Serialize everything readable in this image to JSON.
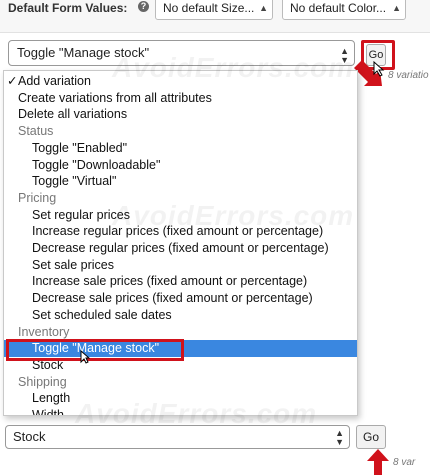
{
  "header": {
    "label": "Default Form Values:",
    "help_icon": "?",
    "size_select": "No default Size...",
    "color_select": "No default Color..."
  },
  "bulk_actions": {
    "selected": "Toggle \"Manage stock\"",
    "go_label": "Go",
    "variation_count": "8 variatio"
  },
  "dropdown": {
    "options": [
      {
        "label": "Add variation",
        "type": "option",
        "checked": true
      },
      {
        "label": "Create variations from all attributes",
        "type": "option"
      },
      {
        "label": "Delete all variations",
        "type": "option"
      },
      {
        "label": "Status",
        "type": "group"
      },
      {
        "label": "Toggle \"Enabled\"",
        "type": "sub"
      },
      {
        "label": "Toggle \"Downloadable\"",
        "type": "sub"
      },
      {
        "label": "Toggle \"Virtual\"",
        "type": "sub"
      },
      {
        "label": "Pricing",
        "type": "group"
      },
      {
        "label": "Set regular prices",
        "type": "sub"
      },
      {
        "label": "Increase regular prices (fixed amount or percentage)",
        "type": "sub"
      },
      {
        "label": "Decrease regular prices (fixed amount or percentage)",
        "type": "sub"
      },
      {
        "label": "Set sale prices",
        "type": "sub"
      },
      {
        "label": "Increase sale prices (fixed amount or percentage)",
        "type": "sub"
      },
      {
        "label": "Decrease sale prices (fixed amount or percentage)",
        "type": "sub"
      },
      {
        "label": "Set scheduled sale dates",
        "type": "sub"
      },
      {
        "label": "Inventory",
        "type": "group"
      },
      {
        "label": "Toggle \"Manage stock\"",
        "type": "sub",
        "highlighted": true
      },
      {
        "label": "Stock",
        "type": "sub"
      },
      {
        "label": "Shipping",
        "type": "group"
      },
      {
        "label": "Length",
        "type": "sub"
      },
      {
        "label": "Width",
        "type": "sub"
      }
    ],
    "check_mark": "✓"
  },
  "bottom": {
    "selected": "Stock",
    "go_label": "Go",
    "variation_count": "8 var"
  },
  "watermark": "AvoidErrors.com",
  "colors": {
    "highlight": "#3a87e0",
    "annotation": "#d0121b"
  }
}
